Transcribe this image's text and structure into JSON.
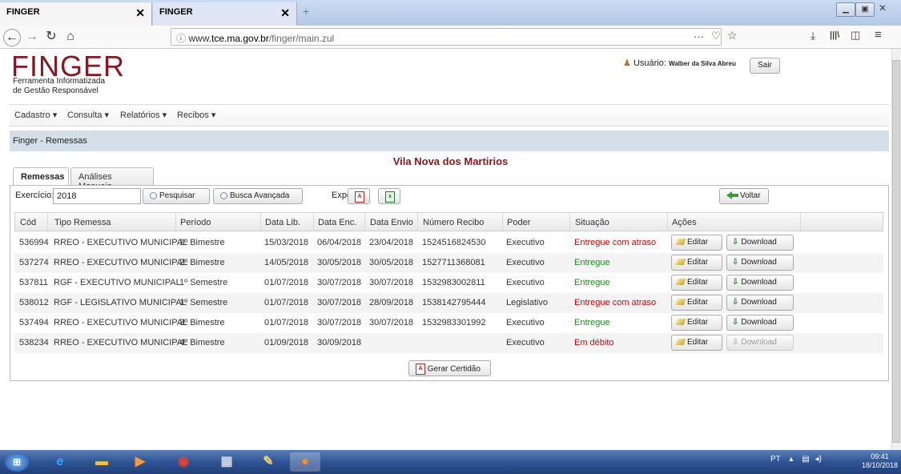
{
  "browser": {
    "tabs": [
      {
        "title": "FINGER",
        "close": "✕"
      },
      {
        "title": "FINGER",
        "close": "✕"
      }
    ],
    "url_info_icon": "ⓘ",
    "url_prefix": "www.",
    "url_host": "tce.ma.gov.br",
    "url_path": "/finger/main.zul",
    "page_actions": "···",
    "icons": [
      "back-icon",
      "forward-icon",
      "reload-icon",
      "home-icon",
      "pocket-icon",
      "bookmark-star-icon",
      "download-icon",
      "library-icon",
      "sidebar-icon",
      "menu-icon"
    ]
  },
  "app": {
    "logo": "FINGER",
    "logo_sub_line1": "Ferramenta Informatizada",
    "logo_sub_line2": "de Gestão Responsável",
    "user_label": "Usuário:",
    "user_name": "Walber da Silva Abreu",
    "logout": "Sair"
  },
  "menu": [
    {
      "label": "Cadastro"
    },
    {
      "label": "Consulta"
    },
    {
      "label": "Relatórios"
    },
    {
      "label": "Recibos"
    }
  ],
  "breadcrumb": "Finger - Remessas",
  "entity_title": "Vila Nova dos Martirios",
  "page_tabs": [
    "Remessas",
    "Análises Manuais"
  ],
  "filters": {
    "exercicio_label": "Exercício:",
    "exercicio_value": "2018",
    "pesquisar": "Pesquisar",
    "busca_avancada": "Busca Avançada",
    "exportar_label": "Exportar:",
    "voltar": "Voltar"
  },
  "table": {
    "headers": [
      "Cód",
      "Tipo Remessa",
      "Período",
      "Data Lib.",
      "Data Enc.",
      "Data Envio",
      "Número Recibo",
      "Poder",
      "Situação",
      "Ações"
    ],
    "edit_label": "Editar",
    "download_label": "Download",
    "rows": [
      {
        "cod": "536994",
        "tipo": "RREO - EXECUTIVO MUNICIPAL",
        "periodo": "1º Bimestre",
        "lib": "15/03/2018",
        "enc": "06/04/2018",
        "envio": "23/04/2018",
        "recibo": "1524516824530",
        "poder": "Executivo",
        "situacao": "Entregue com atraso",
        "status": "late",
        "download_enabled": true
      },
      {
        "cod": "537274",
        "tipo": "RREO - EXECUTIVO MUNICIPAL",
        "periodo": "2º Bimestre",
        "lib": "14/05/2018",
        "enc": "30/05/2018",
        "envio": "30/05/2018",
        "recibo": "1527711368081",
        "poder": "Executivo",
        "situacao": "Entregue",
        "status": "ok",
        "download_enabled": true
      },
      {
        "cod": "537811",
        "tipo": "RGF - EXECUTIVO MUNICIPAL",
        "periodo": "1º Semestre",
        "lib": "01/07/2018",
        "enc": "30/07/2018",
        "envio": "30/07/2018",
        "recibo": "1532983002811",
        "poder": "Executivo",
        "situacao": "Entregue",
        "status": "ok",
        "download_enabled": true
      },
      {
        "cod": "538012",
        "tipo": "RGF - LEGISLATIVO MUNICIPAL",
        "periodo": "1º Semestre",
        "lib": "01/07/2018",
        "enc": "30/07/2018",
        "envio": "28/09/2018",
        "recibo": "1538142795444",
        "poder": "Legislativo",
        "situacao": "Entregue com atraso",
        "status": "late",
        "download_enabled": true
      },
      {
        "cod": "537494",
        "tipo": "RREO - EXECUTIVO MUNICIPAL",
        "periodo": "3º Bimestre",
        "lib": "01/07/2018",
        "enc": "30/07/2018",
        "envio": "30/07/2018",
        "recibo": "1532983301992",
        "poder": "Executivo",
        "situacao": "Entregue",
        "status": "ok",
        "download_enabled": true
      },
      {
        "cod": "538234",
        "tipo": "RREO - EXECUTIVO MUNICIPAL",
        "periodo": "4º Bimestre",
        "lib": "01/09/2018",
        "enc": "30/09/2018",
        "envio": "",
        "recibo": "",
        "poder": "Executivo",
        "situacao": "Em débito",
        "status": "debt",
        "download_enabled": false
      }
    ]
  },
  "gerar_certidao": "Gerar Certidão",
  "taskbar": {
    "lang": "PT",
    "time": "09:41",
    "date": "18/10/2018",
    "apps": [
      "start-orb-icon",
      "ie-icon",
      "explorer-icon",
      "media-player-icon",
      "chrome-icon",
      "calculator-icon",
      "paint-icon",
      "firefox-icon"
    ]
  },
  "colors": {
    "brand": "#8a1620",
    "late": "#d40000",
    "ok": "#1a8a1a",
    "breadcrumb_bg": "#d3e0ea"
  }
}
